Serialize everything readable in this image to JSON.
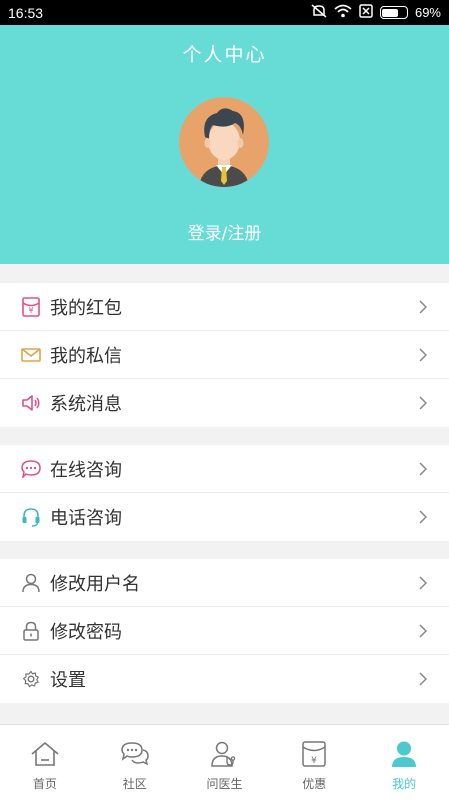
{
  "status_bar": {
    "time": "16:53",
    "battery": "69%",
    "battery_level": 0.69
  },
  "header": {
    "title": "个人中心",
    "login_text": "登录/注册"
  },
  "menu_groups": [
    [
      {
        "label": "我的红包",
        "icon": "red-packet-icon"
      },
      {
        "label": "我的私信",
        "icon": "mail-icon"
      },
      {
        "label": "系统消息",
        "icon": "speaker-icon"
      }
    ],
    [
      {
        "label": "在线咨询",
        "icon": "chat-bubble-icon"
      },
      {
        "label": "电话咨询",
        "icon": "headset-icon"
      }
    ],
    [
      {
        "label": "修改用户名",
        "icon": "user-icon"
      },
      {
        "label": "修改密码",
        "icon": "lock-icon"
      },
      {
        "label": "设置",
        "icon": "gear-icon"
      }
    ]
  ],
  "tabs": [
    {
      "label": "首页",
      "icon": "home-icon"
    },
    {
      "label": "社区",
      "icon": "community-icon"
    },
    {
      "label": "问医生",
      "icon": "doctor-icon"
    },
    {
      "label": "优惠",
      "icon": "coupon-icon"
    },
    {
      "label": "我的",
      "icon": "profile-icon",
      "active": true
    }
  ],
  "colors": {
    "accent": "#67dbd6",
    "tab_active": "#4cc9cc",
    "red_packet": "#e0508a",
    "mail": "#e0a24a",
    "speaker": "#e0508a",
    "chat": "#e0508a",
    "headset": "#38b8c8"
  }
}
